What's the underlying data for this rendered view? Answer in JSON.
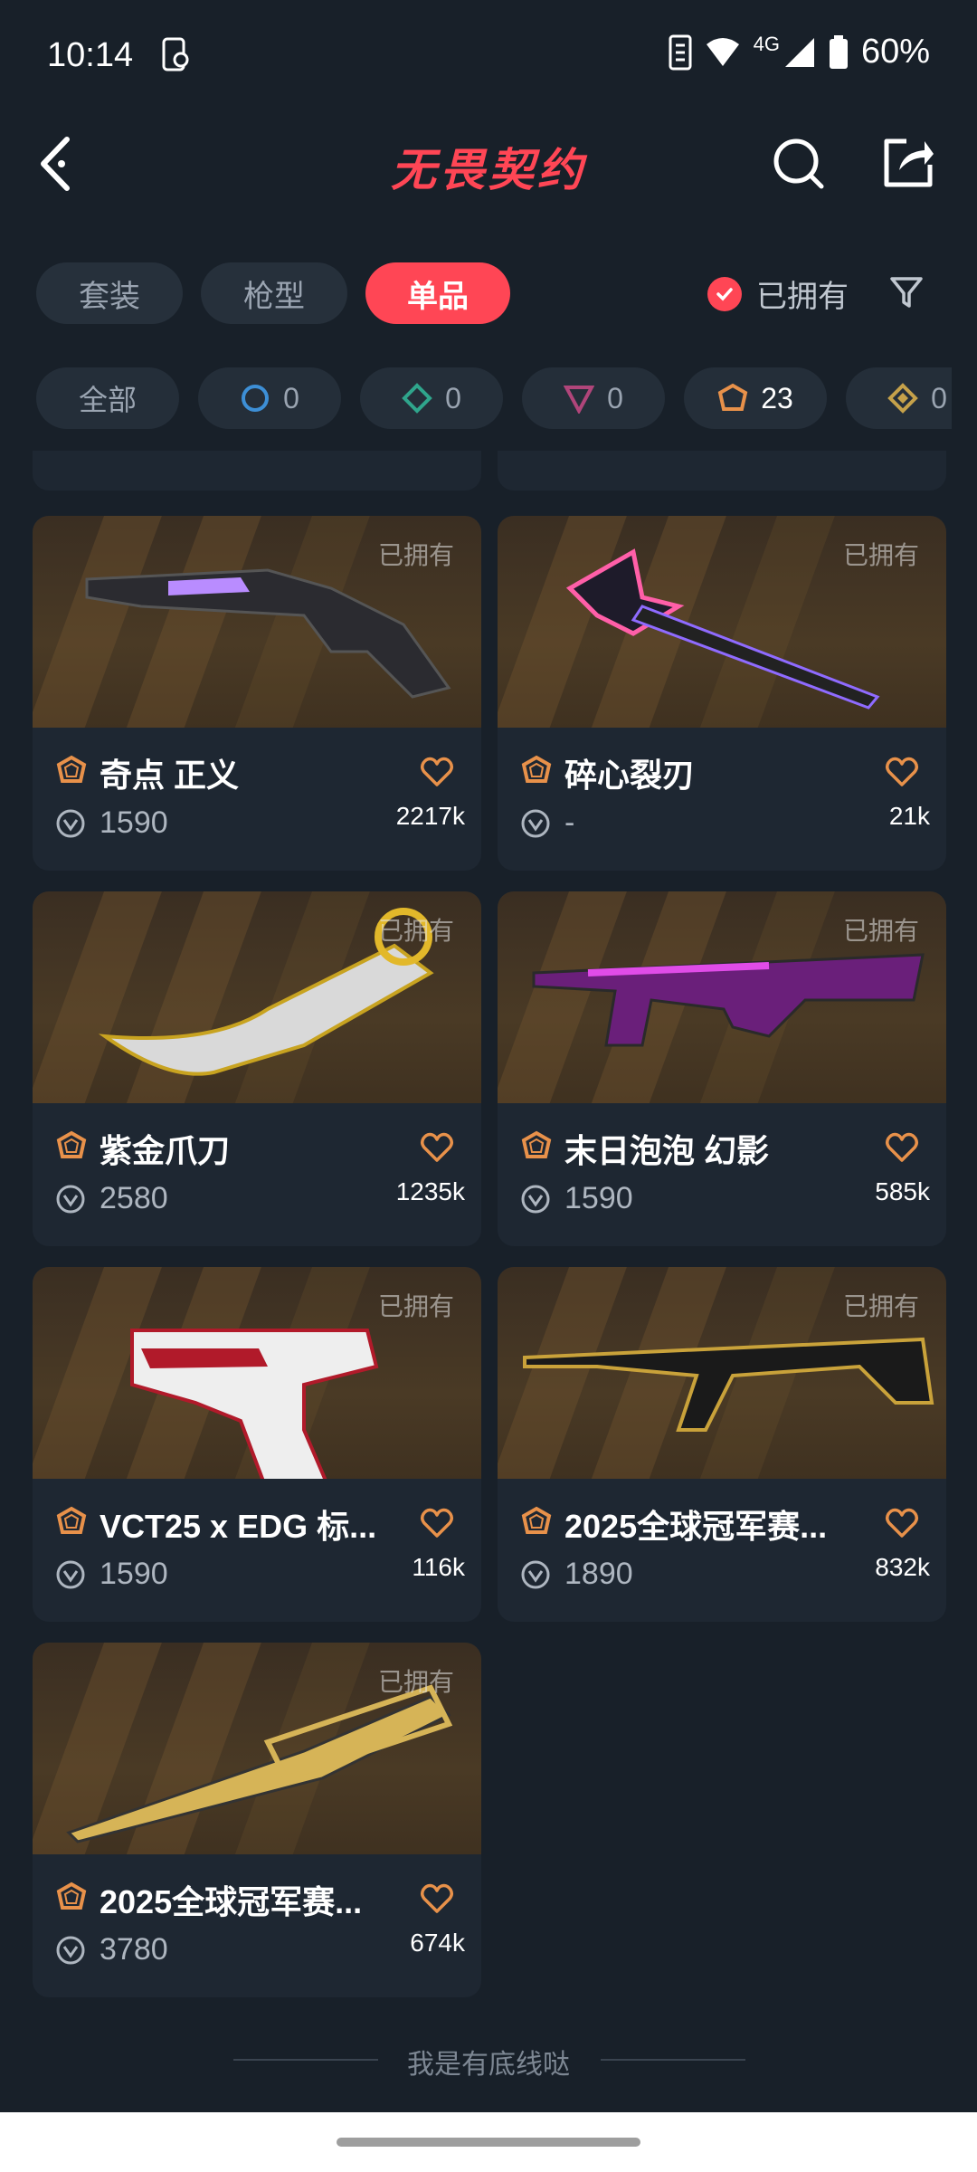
{
  "status_bar": {
    "time": "10:14",
    "network": "4G",
    "battery": "60%"
  },
  "header": {
    "title": "无畏契约"
  },
  "tabs": [
    {
      "label": "套装",
      "active": false
    },
    {
      "label": "枪型",
      "active": false
    },
    {
      "label": "单品",
      "active": true
    }
  ],
  "owned_filter": {
    "label": "已拥有",
    "checked": true
  },
  "chips": [
    {
      "label": "全部"
    },
    {
      "count": "0",
      "tier_color": "#3d8fd6"
    },
    {
      "count": "0",
      "tier_color": "#2fa58c"
    },
    {
      "count": "0",
      "tier_color": "#b0457a"
    },
    {
      "count": "23",
      "tier_color": "#e8914a"
    },
    {
      "count": "0",
      "tier_color": "#c5a14a"
    }
  ],
  "items": [
    {
      "name": "奇点 正义",
      "price": "1590",
      "count": "2217k",
      "owned_label": "已拥有"
    },
    {
      "name": "碎心裂刃",
      "price": "-",
      "count": "21k",
      "owned_label": "已拥有"
    },
    {
      "name": "紫金爪刀",
      "price": "2580",
      "count": "1235k",
      "owned_label": "已拥有"
    },
    {
      "name": "末日泡泡 幻影",
      "price": "1590",
      "count": "585k",
      "owned_label": "已拥有"
    },
    {
      "name": "VCT25 x EDG 标...",
      "price": "1590",
      "count": "116k",
      "owned_label": "已拥有"
    },
    {
      "name": "2025全球冠军赛...",
      "price": "1890",
      "count": "832k",
      "owned_label": "已拥有"
    },
    {
      "name": "2025全球冠军赛...",
      "price": "3780",
      "count": "674k",
      "owned_label": "已拥有"
    }
  ],
  "footer": {
    "text": "我是有底线哒"
  },
  "colors": {
    "accent": "#ff4655",
    "tier_exclusive": "#e8914a",
    "background": "#182029"
  }
}
